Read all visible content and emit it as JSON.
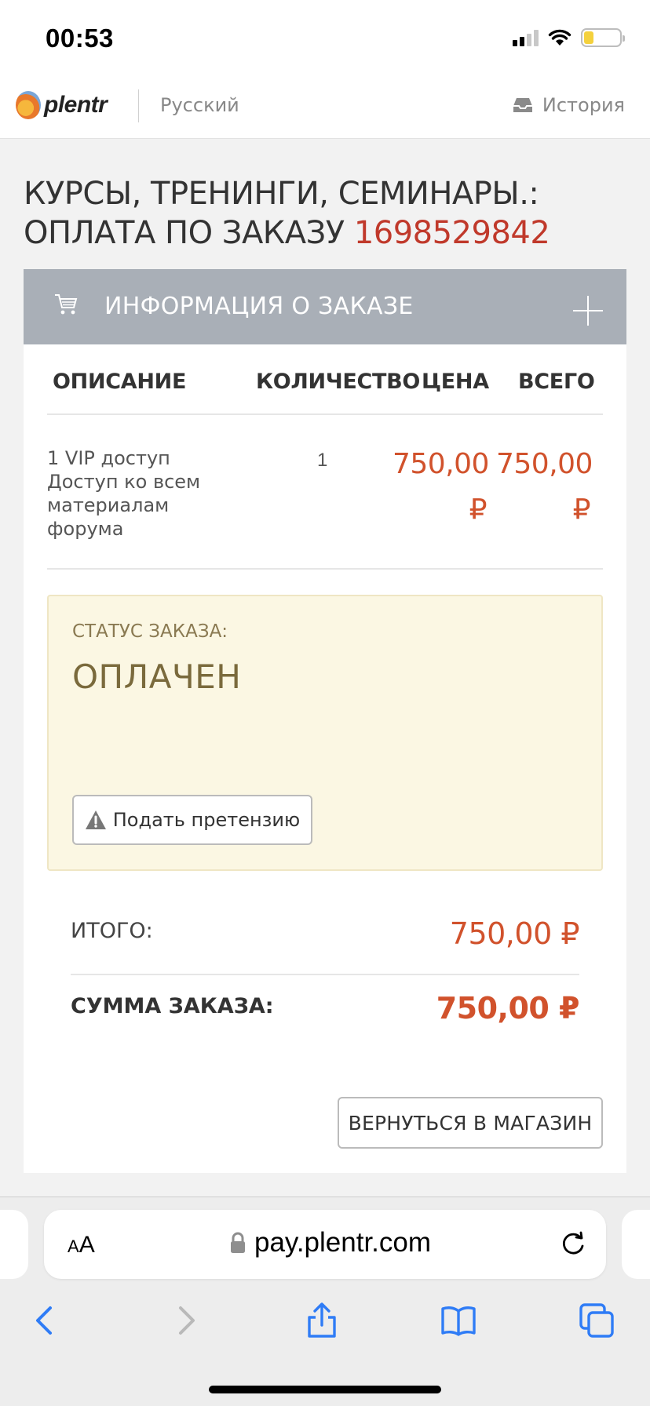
{
  "status_bar": {
    "time": "00:53"
  },
  "header": {
    "brand": "plentr",
    "language": "Русский",
    "history": "История"
  },
  "page": {
    "title_line1": "КУРСЫ, ТРЕНИНГИ, СЕМИНАРЫ.:",
    "title_line2_prefix": "ОПЛАТА ПО ЗАКАЗУ",
    "order_number": "1698529842"
  },
  "order_info": {
    "section_title": "ИНФОРМАЦИЯ О ЗАКАЗЕ",
    "columns": {
      "description": "ОПИСАНИЕ",
      "quantity": "КОЛИЧЕСТВО",
      "price": "ЦЕНА",
      "total": "ВСЕГО"
    },
    "items": [
      {
        "description": "1 VIP доступ Доступ ко всем материалам форума",
        "quantity": "1",
        "price": "750,00 ₽",
        "total": "750,00 ₽"
      }
    ]
  },
  "status": {
    "label": "СТАТУС ЗАКАЗА:",
    "value": "ОПЛАЧЕН",
    "claim_button": "Подать претензию"
  },
  "summary": {
    "subtotal_label": "ИТОГО:",
    "subtotal_value": "750,00 ₽",
    "total_label": "СУММА ЗАКАЗА:",
    "total_value": "750,00 ₽"
  },
  "back_button": "ВЕРНУТЬСЯ В МАГАЗИН",
  "browser": {
    "text_size_label": "AA",
    "url": "pay.plentr.com"
  },
  "colors": {
    "accent_red": "#c0392b",
    "price_orange": "#d1522c",
    "card_header": "#a9afb7",
    "status_bg": "#fbf7e3"
  }
}
